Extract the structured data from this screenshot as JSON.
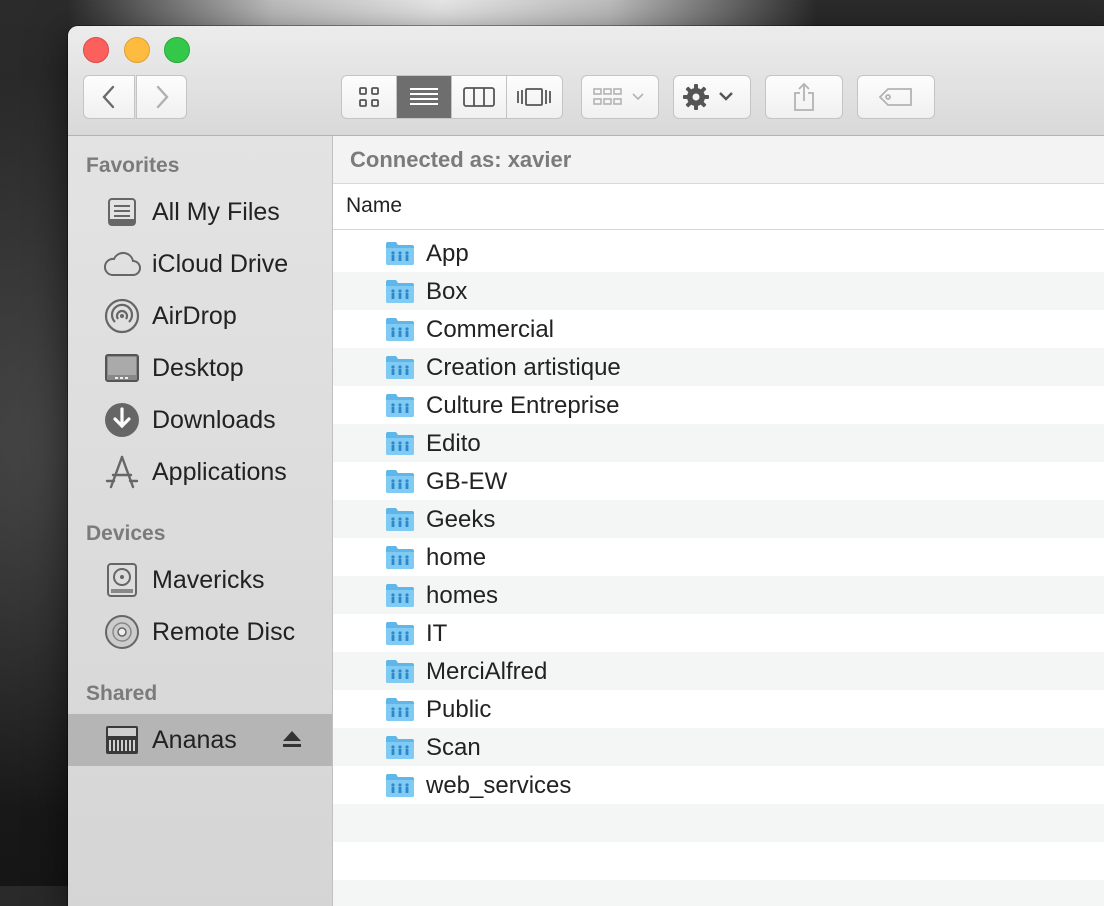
{
  "window": {
    "toolbar": {
      "back_icon": "chevron-left-icon",
      "forward_icon": "chevron-right-icon",
      "view_modes": [
        "icon-view",
        "list-view",
        "column-view",
        "cover-flow-view"
      ],
      "active_view": "list-view",
      "arrange_icon": "arrange-grid-icon",
      "action_icon": "gear-icon",
      "share_icon": "share-icon",
      "tag_icon": "tag-icon"
    }
  },
  "sidebar": {
    "favorites_header": "Favorites",
    "favorites": [
      {
        "label": "All My Files",
        "icon": "all-files-icon"
      },
      {
        "label": "iCloud Drive",
        "icon": "cloud-icon"
      },
      {
        "label": "AirDrop",
        "icon": "airdrop-icon"
      },
      {
        "label": "Desktop",
        "icon": "desktop-icon"
      },
      {
        "label": "Downloads",
        "icon": "download-icon"
      },
      {
        "label": "Applications",
        "icon": "applications-icon"
      }
    ],
    "devices_header": "Devices",
    "devices": [
      {
        "label": "Mavericks",
        "icon": "hard-drive-icon"
      },
      {
        "label": "Remote Disc",
        "icon": "disc-icon"
      }
    ],
    "shared_header": "Shared",
    "shared": [
      {
        "label": "Ananas",
        "icon": "server-icon",
        "eject_icon": "eject-icon",
        "selected": true
      }
    ]
  },
  "main": {
    "connection_status": "Connected as: xavier",
    "column_name": "Name",
    "folders": [
      "App",
      "Box",
      "Commercial",
      "Creation artistique",
      "Culture Entreprise",
      "Edito",
      "GB-EW",
      "Geeks",
      "home",
      "homes",
      "IT",
      "MerciAlfred",
      "Public",
      "Scan",
      "web_services"
    ]
  },
  "colors": {
    "close": "#fc605c",
    "minimize": "#fdbc40",
    "zoom": "#34c84a",
    "folder": "#6dc3f0",
    "selection": "#b5b5b5"
  }
}
